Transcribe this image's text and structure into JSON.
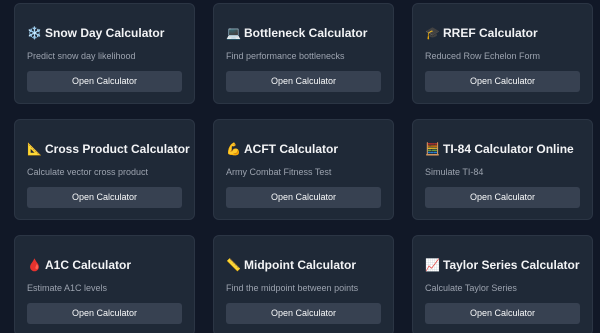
{
  "cards": [
    {
      "icon": "❄️",
      "icon_name": "snowflake-icon",
      "title": "Snow Day Calculator",
      "description": "Predict snow day likelihood",
      "button": "Open Calculator"
    },
    {
      "icon": "💻",
      "icon_name": "laptop-icon",
      "title": "Bottleneck Calculator",
      "description": "Find performance bottlenecks",
      "button": "Open Calculator"
    },
    {
      "icon": "🎓",
      "icon_name": "graduation-cap-icon",
      "title": "RREF Calculator",
      "description": "Reduced Row Echelon Form",
      "button": "Open Calculator"
    },
    {
      "icon": "📐",
      "icon_name": "triangle-ruler-icon",
      "title": "Cross Product Calculator",
      "description": "Calculate vector cross product",
      "button": "Open Calculator"
    },
    {
      "icon": "💪",
      "icon_name": "flexed-arm-icon",
      "title": "ACFT Calculator",
      "description": "Army Combat Fitness Test",
      "button": "Open Calculator"
    },
    {
      "icon": "🧮",
      "icon_name": "calculator-icon",
      "title": "TI-84 Calculator Online",
      "description": "Simulate TI-84",
      "button": "Open Calculator"
    },
    {
      "icon": "🩸",
      "icon_name": "blood-drop-icon",
      "title": "A1C Calculator",
      "description": "Estimate A1C levels",
      "button": "Open Calculator"
    },
    {
      "icon": "📏",
      "icon_name": "ruler-icon",
      "title": "Midpoint Calculator",
      "description": "Find the midpoint between points",
      "button": "Open Calculator"
    },
    {
      "icon": "📈",
      "icon_name": "chart-increasing-icon",
      "title": "Taylor Series Calculator",
      "description": "Calculate Taylor Series",
      "button": "Open Calculator"
    }
  ]
}
